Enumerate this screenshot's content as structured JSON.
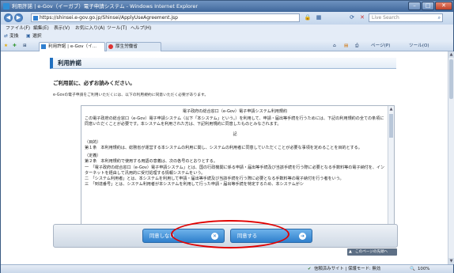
{
  "window": {
    "title": "利用許諾 | e-Gov（イーガブ）電子申請システム - Windows Internet Explorer",
    "minimize": "–",
    "maximize": "□",
    "close": "✕"
  },
  "address": {
    "url": "https://shinsei.e-gov.go.jp/Shinsei/ApplyUseAgreement.jsp",
    "search_placeholder": "Live Search"
  },
  "menu": {
    "items": [
      "ファイル(F)",
      "編集(E)",
      "表示(V)",
      "お気に入り(A)",
      "ツール(T)",
      "ヘルプ(H)"
    ]
  },
  "favbar": {
    "convert": "変換",
    "select": "選択"
  },
  "tabs": [
    {
      "label": "利用許諾 | e-Gov（イ..."
    },
    {
      "label": "厚生労働省"
    }
  ],
  "toolbar": {
    "page": "ページ(P)",
    "tools": "ツール(O)"
  },
  "page": {
    "heading": "利用許諾",
    "read_first": "ご利用前に、必ずお読みください。",
    "note": "e-Govの電子申請をご利用いただくには、以下の利用規約に同意いただく必要があります。",
    "terms": {
      "title": "電子政府の総合窓口（e-Gov）電子申請システム利用規約",
      "intro": "この電子政府の総合窓口（e-Gov）電子申請システム（以下「本システム」という。）を利用して、申請・届出等手続を行うためには、下記の利用規約の全ての条項に同意いただくことが必要です。本システムを利用された方は、下記利用規約に同意したものとみなされます。",
      "ki": "記",
      "a1_title": "（目的）",
      "a1": "第１条　本利用規約は、総務省が運営する本システムの利用に関し、システムの利用者に同意していただくことが必要な事項を定めることを目的とする。",
      "a2_title": "（定義）",
      "a2": "第２条　本利用規約で使用する用語の意義は、次の各号のとおりとする。",
      "a2_1": "一　「電子政府の総合窓口（e-Gov）電子申請システム」とは、国の行政機関に係る申請・届出等手続及び当該手続を行う際に必要となる手数料等の電子納付を、インターネットを経由して汎用的に受付処理する情報システムをいう。",
      "a2_2": "二　「システム利用者」とは、本システムを利用して申請・届出等手続及び当該手続を行う際に必要となる手数料等の電子納付を行う者をいう。",
      "a2_3": "三　「到達番号」とは、システム利用者が本システムを利用して行った申請・届出等手続を特定するため、本システムがシ"
    },
    "disagree_button": "同意しない",
    "agree_button": "同意する",
    "top_link": "このページの先頭へ"
  },
  "status": {
    "trusted": "信頼済みサイト | 保護モード: 無効",
    "zoom": "100%"
  }
}
